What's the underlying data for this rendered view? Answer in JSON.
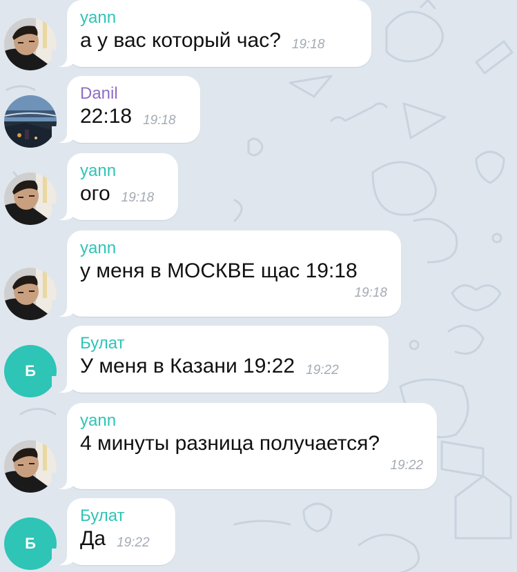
{
  "theme": {
    "background": "#dfe6ee",
    "bubble": "#ffffff",
    "time_color": "#a3abb3",
    "text_color": "#111111"
  },
  "messages": [
    {
      "sender": "yann",
      "sender_color": "#2ec4b6",
      "text": "а у вас который час?",
      "time": "19:18",
      "avatar": "photo-yann"
    },
    {
      "sender": "Danil",
      "sender_color": "#8e6cc7",
      "text": "22:18",
      "time": "19:18",
      "avatar": "photo-danil"
    },
    {
      "sender": "yann",
      "sender_color": "#2ec4b6",
      "text": "ого",
      "time": "19:18",
      "avatar": "photo-yann"
    },
    {
      "sender": "yann",
      "sender_color": "#2ec4b6",
      "text": "у меня в МОСКВЕ щас 19:18",
      "time": "19:18",
      "avatar": "photo-yann"
    },
    {
      "sender": "Булат",
      "sender_color": "#2ec4b6",
      "text": "У меня в Казани 19:22",
      "time": "19:22",
      "avatar_letter": "Б",
      "avatar_color": "#2ec4b6"
    },
    {
      "sender": "yann",
      "sender_color": "#2ec4b6",
      "text": "4 минуты разница получается?",
      "time": "19:22",
      "avatar": "photo-yann"
    },
    {
      "sender": "Булат",
      "sender_color": "#2ec4b6",
      "text": "Да",
      "time": "19:22",
      "avatar_letter": "Б",
      "avatar_color": "#2ec4b6"
    }
  ]
}
